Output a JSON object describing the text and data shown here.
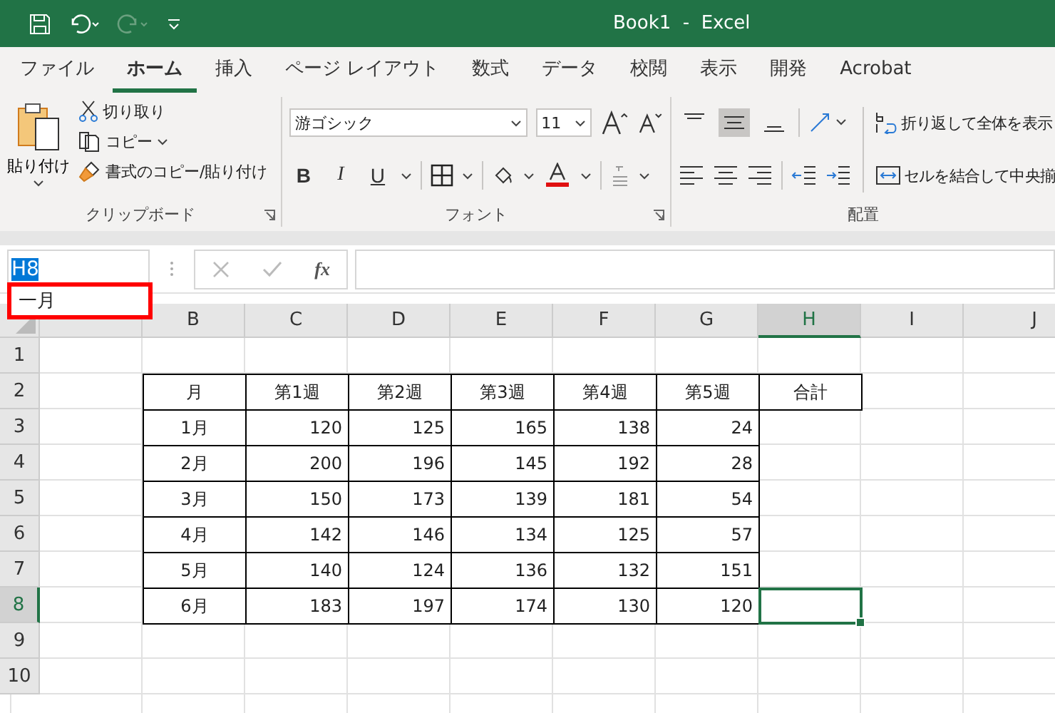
{
  "title_bar": {
    "title": "Book1  -  Excel"
  },
  "tabs": [
    {
      "label": "ファイル",
      "selected": false
    },
    {
      "label": "ホーム",
      "selected": true
    },
    {
      "label": "挿入",
      "selected": false
    },
    {
      "label": "ページ レイアウト",
      "selected": false
    },
    {
      "label": "数式",
      "selected": false
    },
    {
      "label": "データ",
      "selected": false
    },
    {
      "label": "校閲",
      "selected": false
    },
    {
      "label": "表示",
      "selected": false
    },
    {
      "label": "開発",
      "selected": false
    },
    {
      "label": "Acrobat",
      "selected": false
    }
  ],
  "clipboard": {
    "paste": "貼り付け",
    "cut": "切り取り",
    "copy": "コピー",
    "format_painter": "書式のコピー/貼り付け",
    "label": "クリップボード"
  },
  "font": {
    "name": "游ゴシック",
    "size": "11",
    "bold": "B",
    "italic": "I",
    "underline": "U",
    "label": "フォント"
  },
  "alignment": {
    "vertical": [
      {
        "selected": false
      },
      {
        "selected": true
      },
      {
        "selected": false
      }
    ],
    "wrap": "折り返して全体を表示",
    "merge": "セルを結合して中央揃",
    "label": "配置"
  },
  "formula_bar": {
    "name_box": "H8",
    "suggestion": "一月",
    "fx": "fx"
  },
  "sheet": {
    "columns": [
      {
        "selected": false
      },
      {
        "label": "B",
        "selected": false
      },
      {
        "label": "C",
        "selected": false
      },
      {
        "label": "D",
        "selected": false
      },
      {
        "label": "E",
        "selected": false
      },
      {
        "label": "F",
        "selected": false
      },
      {
        "label": "G",
        "selected": false
      },
      {
        "label": "H",
        "selected": true
      },
      {
        "label": "I",
        "selected": false
      },
      {
        "label": "J",
        "selected": false
      }
    ],
    "rows": [
      {
        "label": "1",
        "selected": false
      },
      {
        "label": "2",
        "selected": false
      },
      {
        "label": "3",
        "selected": false
      },
      {
        "label": "4",
        "selected": false
      },
      {
        "label": "5",
        "selected": false
      },
      {
        "label": "6",
        "selected": false
      },
      {
        "label": "7",
        "selected": false
      },
      {
        "label": "8",
        "selected": true
      },
      {
        "label": "9",
        "selected": false
      },
      {
        "label": "10",
        "selected": false
      }
    ],
    "table": {
      "header": [
        "月",
        "第1週",
        "第2週",
        "第3週",
        "第4週",
        "第5週",
        "合計"
      ],
      "rows": [
        {
          "month": "1月",
          "values": [
            "120",
            "125",
            "165",
            "138",
            "24"
          ]
        },
        {
          "month": "2月",
          "values": [
            "200",
            "196",
            "145",
            "192",
            "28"
          ]
        },
        {
          "month": "3月",
          "values": [
            "150",
            "173",
            "139",
            "181",
            "54"
          ]
        },
        {
          "month": "4月",
          "values": [
            "142",
            "146",
            "134",
            "125",
            "57"
          ]
        },
        {
          "month": "5月",
          "values": [
            "140",
            "124",
            "136",
            "132",
            "151"
          ]
        },
        {
          "month": "6月",
          "values": [
            "183",
            "197",
            "174",
            "130",
            "120"
          ]
        }
      ]
    }
  }
}
